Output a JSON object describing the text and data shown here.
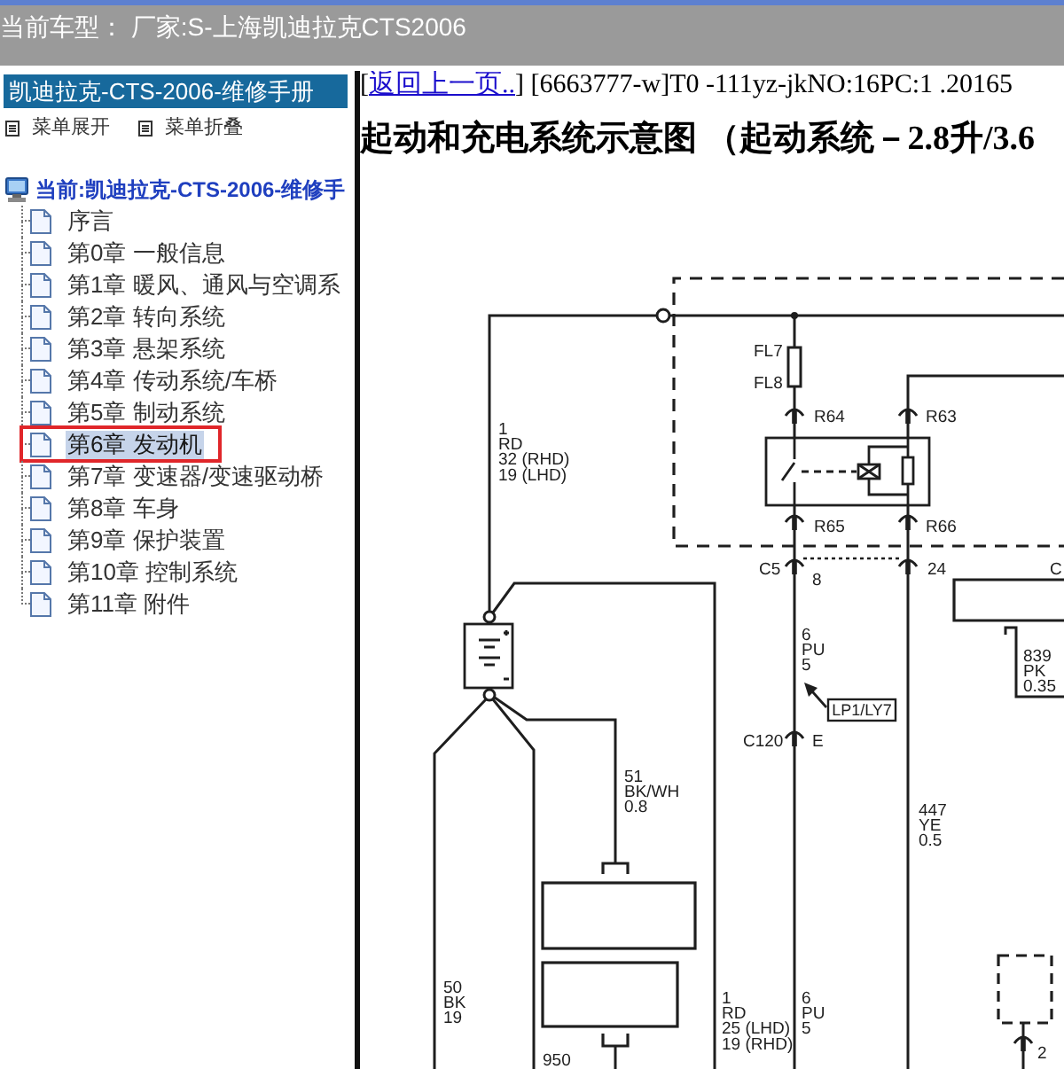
{
  "title_bar": {
    "text": "当前车型： 厂家:S-上海凯迪拉克CTS2006"
  },
  "sidebar": {
    "header": "凯迪拉克-CTS-2006-维修手册",
    "actions": [
      "菜单展开",
      "菜单折叠"
    ],
    "tree": {
      "label": "当前:凯迪拉克-CTS-2006-维修手",
      "children": [
        {
          "label": "序言",
          "selected": false
        },
        {
          "label": "第0章 一般信息",
          "selected": false
        },
        {
          "label": "第1章 暖风、通风与空调系",
          "selected": false
        },
        {
          "label": "第2章 转向系统",
          "selected": false
        },
        {
          "label": "第3章 悬架系统",
          "selected": false
        },
        {
          "label": "第4章 传动系统/车桥",
          "selected": false
        },
        {
          "label": "第5章 制动系统",
          "selected": false
        },
        {
          "label": "第6章 发动机",
          "selected": true
        },
        {
          "label": "第7章 变速器/变速驱动桥",
          "selected": false
        },
        {
          "label": "第8章 车身",
          "selected": false
        },
        {
          "label": "第9章 保护装置",
          "selected": false
        },
        {
          "label": "第10章 控制系统",
          "selected": false
        },
        {
          "label": "第11章 附件",
          "selected": false
        }
      ]
    }
  },
  "document": {
    "nav": {
      "before": "[",
      "link": "返回上一页..",
      "after": "] [6663777-w]T0 -111yz-jkNO:16PC:1 .20165"
    },
    "title": "起动和充电系统示意图 （起动系统－2.8升/3.6",
    "diagram": {
      "labels": [
        [
          "1",
          "RD",
          "32 (RHD)",
          "19 (LHD)"
        ],
        [
          "FL7"
        ],
        [
          "FL8"
        ],
        [
          "R64"
        ],
        [
          "R63"
        ],
        [
          "R65"
        ],
        [
          "R66"
        ],
        [
          "C5"
        ],
        [
          "8"
        ],
        [
          "24"
        ],
        [
          "C"
        ],
        [
          "6",
          "PU",
          "5"
        ],
        [
          "839",
          "PK",
          "0.35"
        ],
        [
          "C120"
        ],
        [
          "E"
        ],
        [
          "51",
          "BK/WH",
          "0.8"
        ],
        [
          "447",
          "YE",
          "0.5"
        ],
        [
          "50",
          "BK",
          "19"
        ],
        [
          "1",
          "RD",
          "25 (LHD)",
          "19 (RHD)"
        ],
        [
          "6",
          "PU",
          "5"
        ],
        [
          "2"
        ],
        [
          "950"
        ]
      ],
      "callout": "LP1/LY7"
    }
  }
}
